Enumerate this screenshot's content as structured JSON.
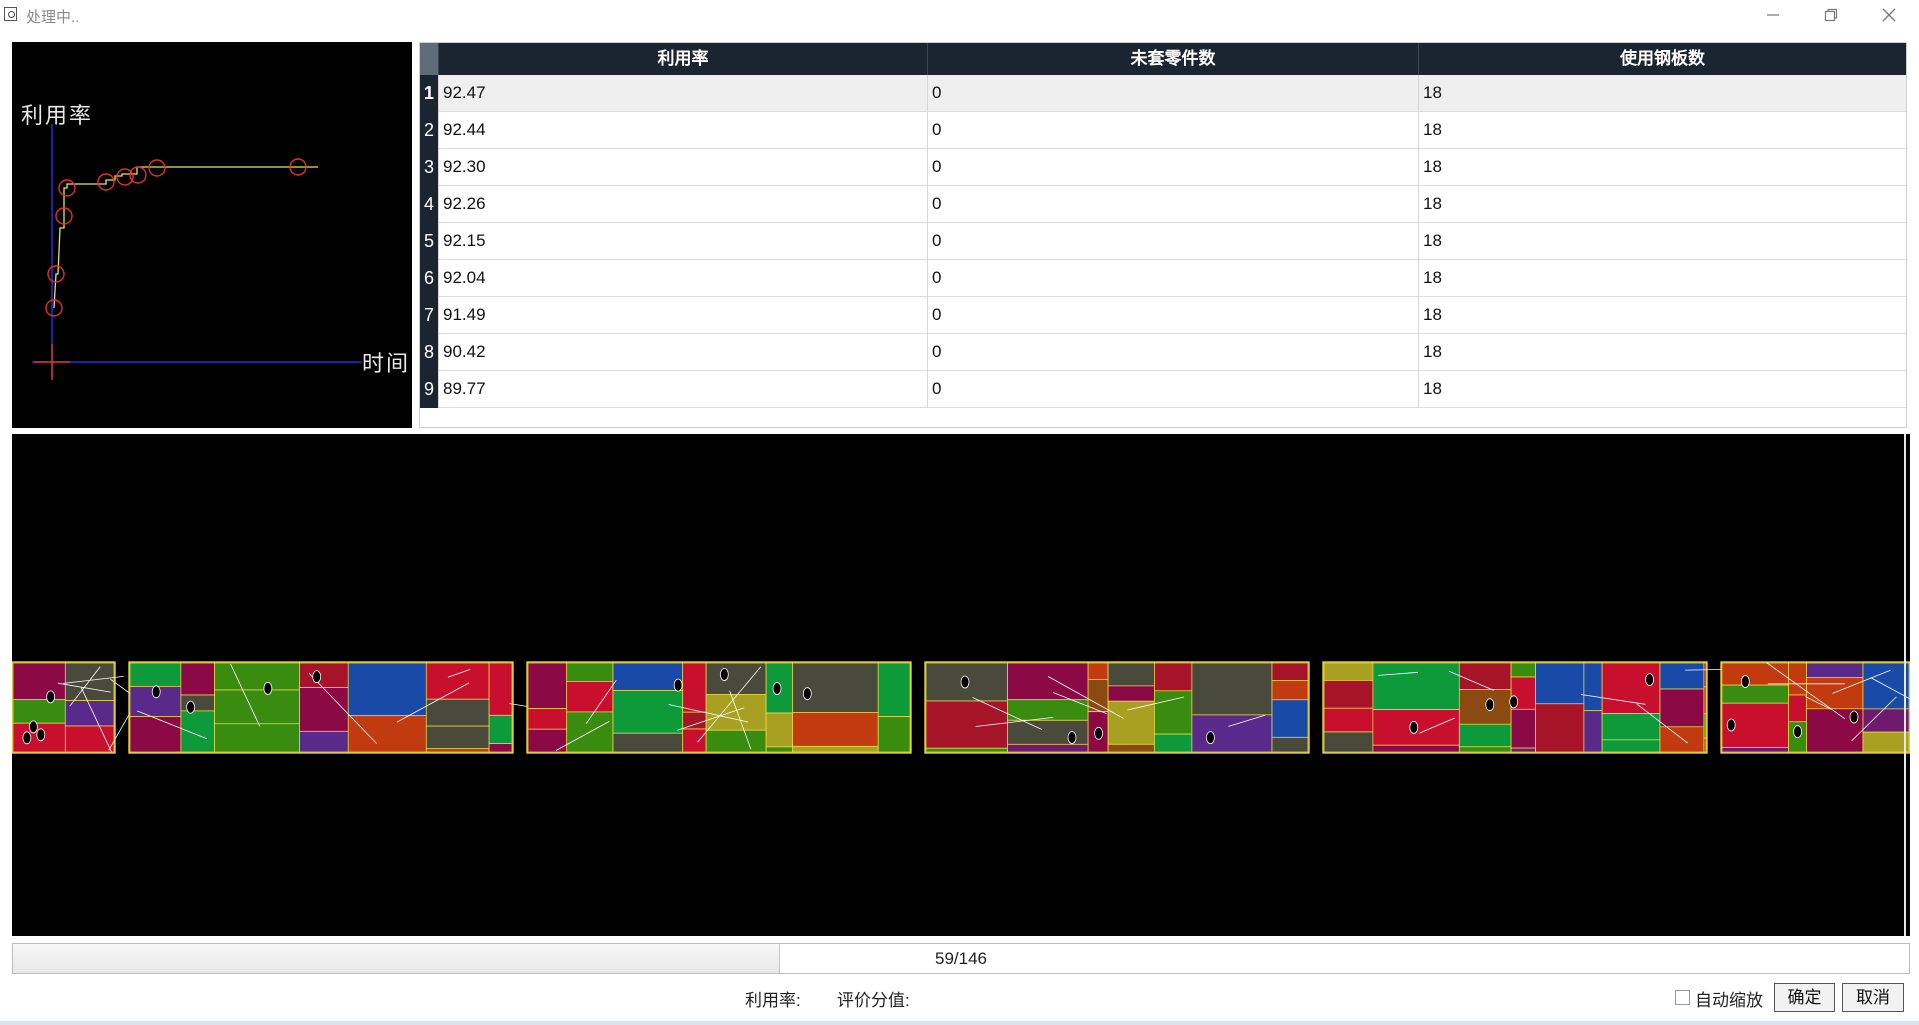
{
  "window": {
    "title": "处理中.."
  },
  "graph": {
    "y_label": "利用率",
    "x_label": "时间"
  },
  "grid": {
    "headers": [
      "利用率",
      "未套零件数",
      "使用钢板数"
    ],
    "rows": [
      [
        "1",
        "92.47",
        "0",
        "18"
      ],
      [
        "2",
        "92.44",
        "0",
        "18"
      ],
      [
        "3",
        "92.30",
        "0",
        "18"
      ],
      [
        "4",
        "92.26",
        "0",
        "18"
      ],
      [
        "5",
        "92.15",
        "0",
        "18"
      ],
      [
        "6",
        "92.04",
        "0",
        "18"
      ],
      [
        "7",
        "91.49",
        "0",
        "18"
      ],
      [
        "8",
        "90.42",
        "0",
        "18"
      ],
      [
        "9",
        "89.77",
        "0",
        "18"
      ]
    ]
  },
  "progress": {
    "text": "59/146",
    "current": 59,
    "total": 146
  },
  "status": {
    "utilization_label": "利用率:",
    "score_label": "评价分值:"
  },
  "controls": {
    "auto_zoom_label": "自动缩放",
    "auto_zoom_checked": false,
    "ok_label": "确定",
    "cancel_label": "取消"
  },
  "colors": {
    "graph_curve": "#e6e65a",
    "graph_marker": "#e03030",
    "graph_axis": "#2a2ad8",
    "grid_header": "#1b2532"
  }
}
